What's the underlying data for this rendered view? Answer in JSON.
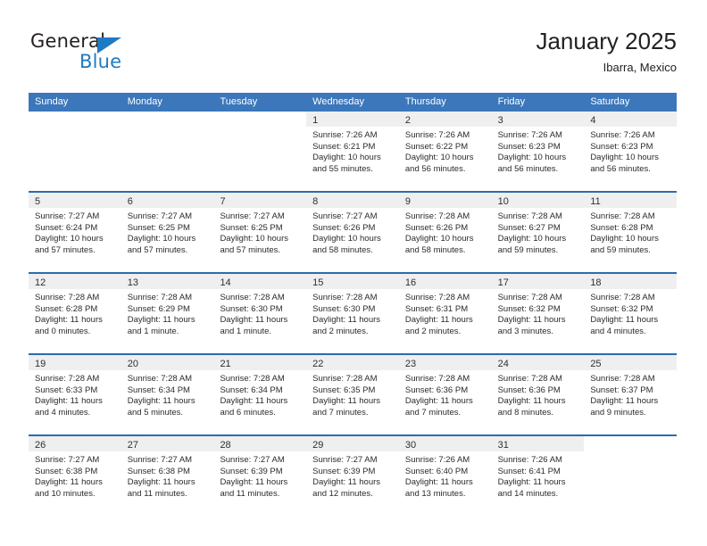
{
  "brand": {
    "name_part1": "General",
    "name_part2": "Blue",
    "triangle_icon": "triangle-icon",
    "accent_color": "#1f7ac4"
  },
  "header": {
    "title": "January 2025",
    "location": "Ibarra, Mexico"
  },
  "colors": {
    "header_bar": "#3b77ba",
    "week_divider": "#2b6cad",
    "daynum_strip": "#efefef"
  },
  "calendar": {
    "weekday_headers": [
      "Sunday",
      "Monday",
      "Tuesday",
      "Wednesday",
      "Thursday",
      "Friday",
      "Saturday"
    ],
    "weeks": [
      [
        {
          "blank": true
        },
        {
          "blank": true
        },
        {
          "blank": true
        },
        {
          "day": "1",
          "sunrise": "Sunrise: 7:26 AM",
          "sunset": "Sunset: 6:21 PM",
          "daylight1": "Daylight: 10 hours",
          "daylight2": "and 55 minutes."
        },
        {
          "day": "2",
          "sunrise": "Sunrise: 7:26 AM",
          "sunset": "Sunset: 6:22 PM",
          "daylight1": "Daylight: 10 hours",
          "daylight2": "and 56 minutes."
        },
        {
          "day": "3",
          "sunrise": "Sunrise: 7:26 AM",
          "sunset": "Sunset: 6:23 PM",
          "daylight1": "Daylight: 10 hours",
          "daylight2": "and 56 minutes."
        },
        {
          "day": "4",
          "sunrise": "Sunrise: 7:26 AM",
          "sunset": "Sunset: 6:23 PM",
          "daylight1": "Daylight: 10 hours",
          "daylight2": "and 56 minutes."
        }
      ],
      [
        {
          "day": "5",
          "sunrise": "Sunrise: 7:27 AM",
          "sunset": "Sunset: 6:24 PM",
          "daylight1": "Daylight: 10 hours",
          "daylight2": "and 57 minutes."
        },
        {
          "day": "6",
          "sunrise": "Sunrise: 7:27 AM",
          "sunset": "Sunset: 6:25 PM",
          "daylight1": "Daylight: 10 hours",
          "daylight2": "and 57 minutes."
        },
        {
          "day": "7",
          "sunrise": "Sunrise: 7:27 AM",
          "sunset": "Sunset: 6:25 PM",
          "daylight1": "Daylight: 10 hours",
          "daylight2": "and 57 minutes."
        },
        {
          "day": "8",
          "sunrise": "Sunrise: 7:27 AM",
          "sunset": "Sunset: 6:26 PM",
          "daylight1": "Daylight: 10 hours",
          "daylight2": "and 58 minutes."
        },
        {
          "day": "9",
          "sunrise": "Sunrise: 7:28 AM",
          "sunset": "Sunset: 6:26 PM",
          "daylight1": "Daylight: 10 hours",
          "daylight2": "and 58 minutes."
        },
        {
          "day": "10",
          "sunrise": "Sunrise: 7:28 AM",
          "sunset": "Sunset: 6:27 PM",
          "daylight1": "Daylight: 10 hours",
          "daylight2": "and 59 minutes."
        },
        {
          "day": "11",
          "sunrise": "Sunrise: 7:28 AM",
          "sunset": "Sunset: 6:28 PM",
          "daylight1": "Daylight: 10 hours",
          "daylight2": "and 59 minutes."
        }
      ],
      [
        {
          "day": "12",
          "sunrise": "Sunrise: 7:28 AM",
          "sunset": "Sunset: 6:28 PM",
          "daylight1": "Daylight: 11 hours",
          "daylight2": "and 0 minutes."
        },
        {
          "day": "13",
          "sunrise": "Sunrise: 7:28 AM",
          "sunset": "Sunset: 6:29 PM",
          "daylight1": "Daylight: 11 hours",
          "daylight2": "and 1 minute."
        },
        {
          "day": "14",
          "sunrise": "Sunrise: 7:28 AM",
          "sunset": "Sunset: 6:30 PM",
          "daylight1": "Daylight: 11 hours",
          "daylight2": "and 1 minute."
        },
        {
          "day": "15",
          "sunrise": "Sunrise: 7:28 AM",
          "sunset": "Sunset: 6:30 PM",
          "daylight1": "Daylight: 11 hours",
          "daylight2": "and 2 minutes."
        },
        {
          "day": "16",
          "sunrise": "Sunrise: 7:28 AM",
          "sunset": "Sunset: 6:31 PM",
          "daylight1": "Daylight: 11 hours",
          "daylight2": "and 2 minutes."
        },
        {
          "day": "17",
          "sunrise": "Sunrise: 7:28 AM",
          "sunset": "Sunset: 6:32 PM",
          "daylight1": "Daylight: 11 hours",
          "daylight2": "and 3 minutes."
        },
        {
          "day": "18",
          "sunrise": "Sunrise: 7:28 AM",
          "sunset": "Sunset: 6:32 PM",
          "daylight1": "Daylight: 11 hours",
          "daylight2": "and 4 minutes."
        }
      ],
      [
        {
          "day": "19",
          "sunrise": "Sunrise: 7:28 AM",
          "sunset": "Sunset: 6:33 PM",
          "daylight1": "Daylight: 11 hours",
          "daylight2": "and 4 minutes."
        },
        {
          "day": "20",
          "sunrise": "Sunrise: 7:28 AM",
          "sunset": "Sunset: 6:34 PM",
          "daylight1": "Daylight: 11 hours",
          "daylight2": "and 5 minutes."
        },
        {
          "day": "21",
          "sunrise": "Sunrise: 7:28 AM",
          "sunset": "Sunset: 6:34 PM",
          "daylight1": "Daylight: 11 hours",
          "daylight2": "and 6 minutes."
        },
        {
          "day": "22",
          "sunrise": "Sunrise: 7:28 AM",
          "sunset": "Sunset: 6:35 PM",
          "daylight1": "Daylight: 11 hours",
          "daylight2": "and 7 minutes."
        },
        {
          "day": "23",
          "sunrise": "Sunrise: 7:28 AM",
          "sunset": "Sunset: 6:36 PM",
          "daylight1": "Daylight: 11 hours",
          "daylight2": "and 7 minutes."
        },
        {
          "day": "24",
          "sunrise": "Sunrise: 7:28 AM",
          "sunset": "Sunset: 6:36 PM",
          "daylight1": "Daylight: 11 hours",
          "daylight2": "and 8 minutes."
        },
        {
          "day": "25",
          "sunrise": "Sunrise: 7:28 AM",
          "sunset": "Sunset: 6:37 PM",
          "daylight1": "Daylight: 11 hours",
          "daylight2": "and 9 minutes."
        }
      ],
      [
        {
          "day": "26",
          "sunrise": "Sunrise: 7:27 AM",
          "sunset": "Sunset: 6:38 PM",
          "daylight1": "Daylight: 11 hours",
          "daylight2": "and 10 minutes."
        },
        {
          "day": "27",
          "sunrise": "Sunrise: 7:27 AM",
          "sunset": "Sunset: 6:38 PM",
          "daylight1": "Daylight: 11 hours",
          "daylight2": "and 11 minutes."
        },
        {
          "day": "28",
          "sunrise": "Sunrise: 7:27 AM",
          "sunset": "Sunset: 6:39 PM",
          "daylight1": "Daylight: 11 hours",
          "daylight2": "and 11 minutes."
        },
        {
          "day": "29",
          "sunrise": "Sunrise: 7:27 AM",
          "sunset": "Sunset: 6:39 PM",
          "daylight1": "Daylight: 11 hours",
          "daylight2": "and 12 minutes."
        },
        {
          "day": "30",
          "sunrise": "Sunrise: 7:26 AM",
          "sunset": "Sunset: 6:40 PM",
          "daylight1": "Daylight: 11 hours",
          "daylight2": "and 13 minutes."
        },
        {
          "day": "31",
          "sunrise": "Sunrise: 7:26 AM",
          "sunset": "Sunset: 6:41 PM",
          "daylight1": "Daylight: 11 hours",
          "daylight2": "and 14 minutes."
        },
        {
          "blank": true
        }
      ]
    ]
  }
}
